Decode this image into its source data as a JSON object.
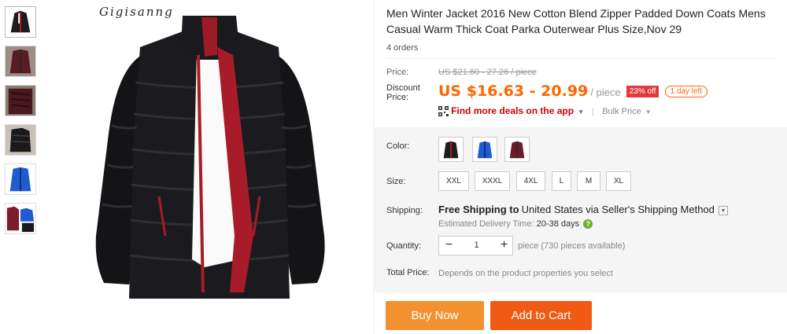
{
  "watermark": "Gigisanng",
  "thumbnails": [
    {
      "name": "thumb-black-jacket",
      "color": "#1c1c1f",
      "accent": "#b01c2a"
    },
    {
      "name": "thumb-burgundy-jacket",
      "color": "#5a1a26",
      "accent": "#2a2a2a"
    },
    {
      "name": "thumb-burgundy-detail",
      "color": "#4a1822",
      "accent": "#111"
    },
    {
      "name": "thumb-black-side",
      "color": "#1a1a1d",
      "accent": "#444"
    },
    {
      "name": "thumb-blue-jacket",
      "color": "#1e5ccf",
      "accent": "#0c2d7a"
    },
    {
      "name": "thumb-group",
      "color": "#7a1d2a",
      "accent": "#1e5ccf"
    }
  ],
  "product": {
    "title": "Men Winter Jacket 2016 New Cotton Blend Zipper Padded Down Coats Mens Casual Warm Thick Coat Parka Outerwear Plus Size,Nov 29",
    "orders": "4 orders"
  },
  "price": {
    "label": "Price:",
    "original": "US $21.60 - 27.26 / piece",
    "discount_label": "Discount Price:",
    "discount": "US $16.63 - 20.99",
    "per": "/ piece",
    "off": "23% off",
    "time_left": "1 day left"
  },
  "deals": {
    "label": "Find more deals on the app",
    "bulk": "Bulk Price"
  },
  "color": {
    "label": "Color:",
    "options": [
      {
        "name": "color-black",
        "body": "#1c1c1f",
        "accent": "#b01c2a"
      },
      {
        "name": "color-blue",
        "body": "#1e5ccf",
        "accent": "#0c2d7a"
      },
      {
        "name": "color-burgundy",
        "body": "#6b1b27",
        "accent": "#2a2a2a"
      }
    ]
  },
  "size": {
    "label": "Size:",
    "options": [
      "XXL",
      "XXXL",
      "4XL",
      "L",
      "M",
      "XL"
    ]
  },
  "shipping": {
    "label": "Shipping:",
    "free": "Free Shipping to",
    "destination": "United States via Seller's Shipping Method",
    "delivery_label": "Estimated Delivery Time:",
    "delivery_days": "20-38 days"
  },
  "quantity": {
    "label": "Quantity:",
    "value": "1",
    "available": "piece (730 pieces available)"
  },
  "total": {
    "label": "Total Price:",
    "value": "Depends on the product properties you select"
  },
  "buttons": {
    "buy": "Buy Now",
    "cart": "Add to Cart"
  },
  "colors": {
    "discount": "#ff6600",
    "buy_button": "#f39131",
    "cart_button": "#ef5b12",
    "badge": "#e4393c"
  }
}
